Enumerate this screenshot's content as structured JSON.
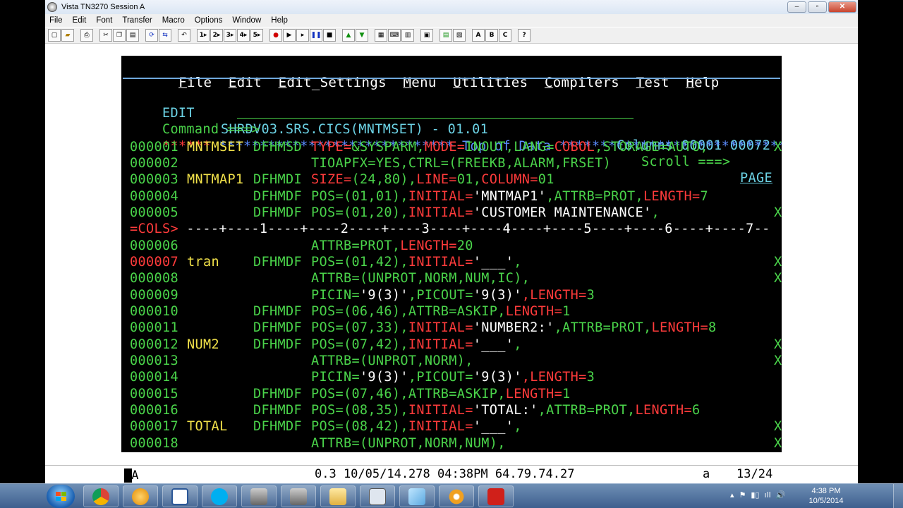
{
  "window": {
    "title": "Vista TN3270 Session A",
    "min": "–",
    "max": "▫",
    "close": "✕"
  },
  "menu": [
    "File",
    "Edit",
    "Font",
    "Transfer",
    "Macro",
    "Options",
    "Window",
    "Help"
  ],
  "toolbar": {
    "buttons": [
      "new",
      "open",
      "print",
      "cut",
      "copy",
      "paste",
      "refresh",
      "sync",
      "undo",
      "1",
      "2",
      "3",
      "4",
      "5",
      "record",
      "play",
      "step",
      "pause",
      "stop",
      "send",
      "receive",
      "keypad",
      "keyboard",
      "grid",
      "macros",
      "notes",
      "spell",
      "A",
      "B",
      "C",
      "?"
    ]
  },
  "ispf": {
    "menu": [
      {
        "first": "F",
        "rest": "ile"
      },
      {
        "first": "E",
        "rest": "dit"
      },
      {
        "first": "E",
        "rest": "dit_Settings"
      },
      {
        "first": "M",
        "rest": "enu"
      },
      {
        "first": "U",
        "rest": "tilities"
      },
      {
        "first": "C",
        "rest": "ompilers"
      },
      {
        "first": "T",
        "rest": "est"
      },
      {
        "first": "H",
        "rest": "elp"
      }
    ],
    "mode": "EDIT",
    "dataset": "SHRDV03.SRS.CICS(MNTMSET) - 01.01",
    "columns_label": "Columns 00001 00072",
    "command_label": "Command ===>",
    "command_value": "",
    "scroll_label": "Scroll ===>",
    "scroll_value": "PAGE",
    "top_of_data": {
      "stars": "******",
      "left": " ***************************** ",
      "text": "Top of Data",
      "right": " ******************************"
    },
    "cols_ruler": {
      "label": "=COLS>",
      "ruler": " ----+----1----+----2----+----3----+----4----+----5----+----6----+----7--"
    },
    "lines": [
      {
        "num": "000001",
        "label": "MNTMSET",
        "macro": "DFHMSD",
        "parts": [
          [
            "r",
            "TYPE="
          ],
          [
            "g",
            "&SYSPARM,"
          ],
          [
            "r",
            "MODE="
          ],
          [
            "g",
            "INOUT,LANG="
          ],
          [
            "r",
            "COBOL"
          ],
          [
            "g",
            ",STORAGE=AUTO,"
          ]
        ],
        "cont": "X"
      },
      {
        "num": "000002",
        "label": "",
        "macro": "",
        "parts": [
          [
            "g",
            "TIOAPFX=YES,CTRL=(FREEKB,ALARM,FRSET)"
          ]
        ],
        "cont": ""
      },
      {
        "num": "000003",
        "label": "MNTMAP1",
        "macro": "DFHMDI",
        "parts": [
          [
            "r",
            "SIZE="
          ],
          [
            "g",
            "(24,80),"
          ],
          [
            "r",
            "LINE="
          ],
          [
            "g",
            "01,"
          ],
          [
            "r",
            "COLUMN="
          ],
          [
            "g",
            "01"
          ]
        ],
        "cont": ""
      },
      {
        "num": "000004",
        "label": "",
        "macro": "DFHMDF",
        "parts": [
          [
            "g",
            "POS=(01,01),"
          ],
          [
            "r",
            "INITIAL="
          ],
          [
            "w",
            "'MNTMAP1'"
          ],
          [
            "g",
            ",ATTRB=PROT,"
          ],
          [
            "r",
            "LENGTH="
          ],
          [
            "g",
            "7"
          ]
        ],
        "cont": ""
      },
      {
        "num": "000005",
        "label": "",
        "macro": "DFHMDF",
        "parts": [
          [
            "g",
            "POS=(01,20),"
          ],
          [
            "r",
            "INITIAL="
          ],
          [
            "w",
            "'CUSTOMER MAINTENANCE'"
          ],
          [
            "g",
            ","
          ]
        ],
        "cont": "X"
      },
      {
        "num": "000006",
        "label": "",
        "macro": "",
        "parts": [
          [
            "g",
            "ATTRB=PROT,"
          ],
          [
            "r",
            "LENGTH="
          ],
          [
            "g",
            "20"
          ]
        ],
        "cont": ""
      },
      {
        "num": "000007",
        "label": "tran",
        "macro": "DFHMDF",
        "parts": [
          [
            "g",
            "POS=(01,42),"
          ],
          [
            "r",
            "INITIAL="
          ],
          [
            "w",
            "'___'"
          ],
          [
            "g",
            ","
          ]
        ],
        "cont": "X"
      },
      {
        "num": "000008",
        "label": "",
        "macro": "",
        "parts": [
          [
            "g",
            "ATTRB=(UNPROT,NORM,NUM,IC),"
          ]
        ],
        "cont": "X"
      },
      {
        "num": "000009",
        "label": "",
        "macro": "",
        "parts": [
          [
            "g",
            "PICIN="
          ],
          [
            "w",
            "'9(3)'"
          ],
          [
            "g",
            ",PICOUT="
          ],
          [
            "w",
            "'9(3)'"
          ],
          [
            "r",
            ",LENGTH="
          ],
          [
            "g",
            "3"
          ]
        ],
        "cont": ""
      },
      {
        "num": "000010",
        "label": "",
        "macro": "DFHMDF",
        "parts": [
          [
            "g",
            "POS=(06,46),ATTRB=ASKIP,"
          ],
          [
            "r",
            "LENGTH="
          ],
          [
            "g",
            "1"
          ]
        ],
        "cont": ""
      },
      {
        "num": "000011",
        "label": "",
        "macro": "DFHMDF",
        "parts": [
          [
            "g",
            "POS=(07,33),"
          ],
          [
            "r",
            "INITIAL="
          ],
          [
            "w",
            "'NUMBER2:'"
          ],
          [
            "g",
            ",ATTRB=PROT,"
          ],
          [
            "r",
            "LENGTH="
          ],
          [
            "g",
            "8"
          ]
        ],
        "cont": ""
      },
      {
        "num": "000012",
        "label": "NUM2",
        "macro": "DFHMDF",
        "parts": [
          [
            "g",
            "POS=(07,42),"
          ],
          [
            "r",
            "INITIAL="
          ],
          [
            "w",
            "'___'"
          ],
          [
            "g",
            ","
          ]
        ],
        "cont": "X"
      },
      {
        "num": "000013",
        "label": "",
        "macro": "",
        "parts": [
          [
            "g",
            "ATTRB=(UNPROT,NORM),"
          ]
        ],
        "cont": "X"
      },
      {
        "num": "000014",
        "label": "",
        "macro": "",
        "parts": [
          [
            "g",
            "PICIN="
          ],
          [
            "w",
            "'9(3)'"
          ],
          [
            "g",
            ",PICOUT="
          ],
          [
            "w",
            "'9(3)'"
          ],
          [
            "r",
            ",LENGTH="
          ],
          [
            "g",
            "3"
          ]
        ],
        "cont": ""
      },
      {
        "num": "000015",
        "label": "",
        "macro": "DFHMDF",
        "parts": [
          [
            "g",
            "POS=(07,46),ATTRB=ASKIP,"
          ],
          [
            "r",
            "LENGTH="
          ],
          [
            "g",
            "1"
          ]
        ],
        "cont": ""
      },
      {
        "num": "000016",
        "label": "",
        "macro": "DFHMDF",
        "parts": [
          [
            "g",
            "POS=(08,35),"
          ],
          [
            "r",
            "INITIAL="
          ],
          [
            "w",
            "'TOTAL:'"
          ],
          [
            "g",
            ",ATTRB=PROT,"
          ],
          [
            "r",
            "LENGTH="
          ],
          [
            "g",
            "6"
          ]
        ],
        "cont": ""
      },
      {
        "num": "000017",
        "label": "TOTAL",
        "macro": "DFHMDF",
        "parts": [
          [
            "g",
            "POS=(08,42),"
          ],
          [
            "r",
            "INITIAL="
          ],
          [
            "w",
            "'___'"
          ],
          [
            "g",
            ","
          ]
        ],
        "cont": "X"
      },
      {
        "num": "000018",
        "label": "",
        "macro": "",
        "parts": [
          [
            "g",
            "ATTRB=(UNPROT,NORM,NUM),"
          ]
        ],
        "cont": "X"
      }
    ]
  },
  "status": {
    "left": "MA",
    "info": "0.3 10/05/14.278 04:38PM 64.79.74.27",
    "mode": "a",
    "position": "13/24"
  },
  "taskbar": {
    "apps": [
      "Chrome",
      "Clock",
      "Word",
      "Skype",
      "TN3270 A",
      "TN3270 B",
      "Explorer",
      "Calculator",
      "Notes",
      "Flower",
      "Acrobat"
    ],
    "tray": "▴  ⚑  ▮▯  ıll  🔊",
    "time": "4:38 PM",
    "date": "10/5/2014"
  }
}
